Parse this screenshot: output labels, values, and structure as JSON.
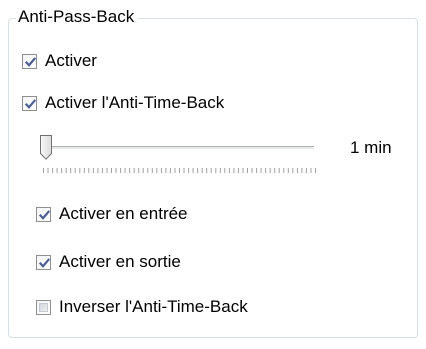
{
  "group": {
    "title": "Anti-Pass-Back"
  },
  "options": {
    "enable": {
      "label": "Activer",
      "checked": true
    },
    "enable_anti_time_back": {
      "label": "Activer l'Anti-Time-Back",
      "checked": true
    },
    "enable_entry": {
      "label": "Activer en entrée",
      "checked": true
    },
    "enable_exit": {
      "label": "Activer en sortie",
      "checked": true
    },
    "invert_anti_time_back": {
      "label": "Inverser  l'Anti-Time-Back",
      "checked": false
    }
  },
  "slider": {
    "value_label": "1 min",
    "position_fraction": 0.0
  },
  "colors": {
    "checkmark": "#4a5f97",
    "group_border": "#d5dfe5"
  }
}
